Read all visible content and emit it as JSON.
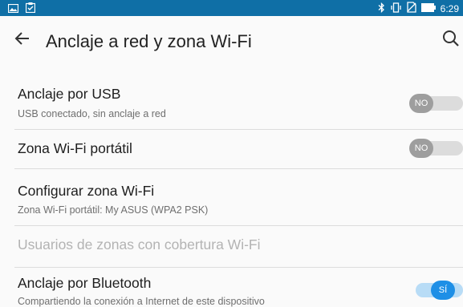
{
  "status_bar": {
    "time": "6:29",
    "left_icons": [
      "photo-icon",
      "clipboard-check-icon"
    ],
    "right_icons": [
      "bluetooth-icon",
      "vibrate-icon",
      "no-sim-icon",
      "battery-icon"
    ],
    "background": "#0f6fa6"
  },
  "app_bar": {
    "title": "Anclaje a red y zona Wi-Fi",
    "back_icon": "arrow-back-icon",
    "search_icon": "search-icon"
  },
  "settings": {
    "usb": {
      "title": "Anclaje por USB",
      "subtitle": "USB conectado, sin anclaje a red",
      "toggle_label": "NO",
      "enabled": false
    },
    "hotspot": {
      "title": "Zona Wi-Fi portátil",
      "toggle_label": "NO",
      "enabled": false
    },
    "configure": {
      "title": "Configurar zona Wi-Fi",
      "subtitle": "Zona Wi-Fi portátil: My ASUS (WPA2 PSK)"
    },
    "users": {
      "title": "Usuarios de zonas con cobertura Wi-Fi",
      "disabled": true
    },
    "bluetooth": {
      "title": "Anclaje por Bluetooth",
      "subtitle": "Compartiendo la conexión a Internet de este dispositivo",
      "toggle_label": "SÍ",
      "enabled": true
    }
  },
  "colors": {
    "accent": "#1e8fe6",
    "toggle_off_thumb": "#9e9e9e",
    "toggle_off_track": "#dcdcdc",
    "toggle_on_track": "#b8dcf6"
  }
}
